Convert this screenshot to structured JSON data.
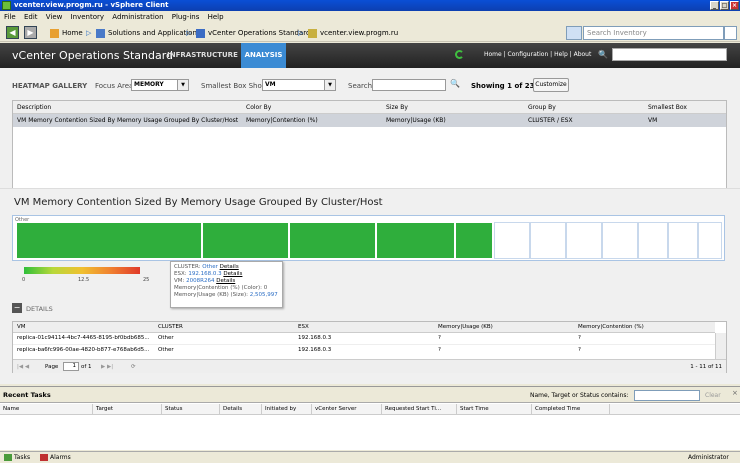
{
  "window": {
    "title": "vcenter.view.progm.ru - vSphere Client"
  },
  "menu": [
    "File",
    "Edit",
    "View",
    "Inventory",
    "Administration",
    "Plug-ins",
    "Help"
  ],
  "nav": {
    "home_label": "Home",
    "solutions_label": "Solutions and Applications",
    "vcops_label": "vCenter Operations Standard",
    "host_label": "vcenter.view.progm.ru",
    "search_placeholder": "Search Inventory"
  },
  "vcops": {
    "title": "vCenter Operations Standard",
    "tab_infrastructure": "INFRASTRUCTURE",
    "tab_analysis": "ANALYSIS",
    "links": "Home | Configuration | Help | About"
  },
  "gallery": {
    "title": "HEATMAP GALLERY",
    "focus_label": "Focus Area",
    "focus_value": "MEMORY",
    "box_label": "Smallest Box Shows",
    "box_value": "VM",
    "search_label": "Search",
    "showing": "Showing 1 of 23",
    "customize_label": "Customize",
    "columns": [
      "Description",
      "Color By",
      "Size By",
      "Group By",
      "Smallest Box"
    ],
    "row": [
      "VM Memory Contention Sized By Memory Usage Grouped By Cluster/Host",
      "Memory|Contention (%)",
      "Memory|Usage (KB)",
      "CLUSTER / ESX",
      "VM"
    ]
  },
  "heatmap": {
    "title": "VM Memory Contention Sized By Memory Usage Grouped By Cluster/Host",
    "group_label": "Other",
    "legend": [
      "0",
      "12.5",
      "25"
    ],
    "tooltip": {
      "cluster_label": "CLUSTER:",
      "cluster_value": "Other",
      "esx_label": "ESX:",
      "esx_value": "192.168.0.3",
      "vm_label": "VM:",
      "vm_value": "2008R264",
      "details": "Details",
      "color_line": "Memory|Contention (%) (Color): 0",
      "size_label": "Memory|Usage (KB) (Size):",
      "size_value": "2,505,997"
    }
  },
  "details": {
    "label": "DETAILS",
    "columns": [
      "VM",
      "CLUSTER",
      "ESX",
      "Memory|Usage (KB)",
      "Memory|Contention (%)"
    ],
    "rows": [
      [
        "replica-01c94114-4bc7-4465-8195-bf0bdb685...",
        "Other",
        "192.168.0.3",
        "?",
        "?"
      ],
      [
        "replica-ba6fc996-00ae-4820-b877-e768ab6d5...",
        "Other",
        "192.168.0.3",
        "?",
        "?"
      ]
    ],
    "pager_page": "Page",
    "pager_value": "1",
    "pager_of": "of 1",
    "pager_count": "1 - 11 of 11"
  },
  "tasks": {
    "title": "Recent Tasks",
    "filter_label": "Name, Target or Status contains:",
    "clear_label": "Clear",
    "columns": [
      "Name",
      "Target",
      "Status",
      "Details",
      "Initiated by",
      "vCenter Server",
      "Requested Start Ti...",
      "Start Time",
      "Completed Time"
    ]
  },
  "statusbar": {
    "tasks": "Tasks",
    "alarms": "Alarms",
    "user": "Administrator"
  },
  "colors": {
    "accent": "#3b8bd4",
    "heat_green": "#2fae3c",
    "titlebar": "#0a4fd6"
  }
}
